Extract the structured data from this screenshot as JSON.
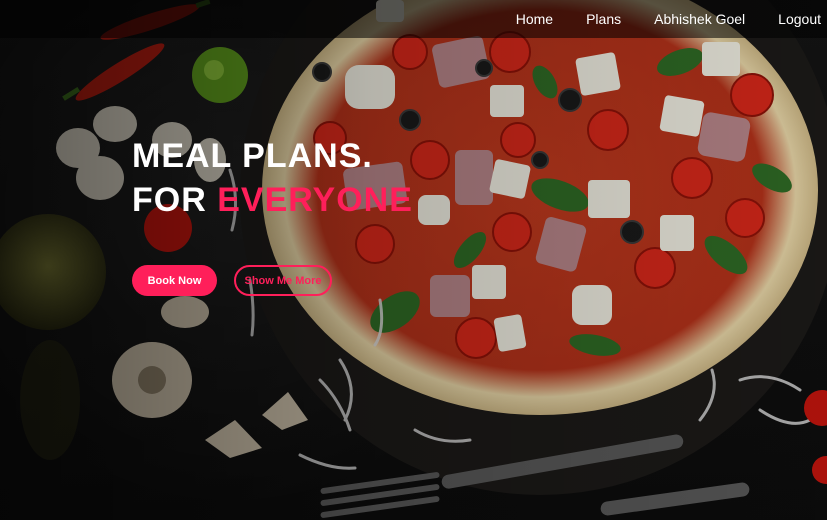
{
  "nav": {
    "items": [
      {
        "label": "Home"
      },
      {
        "label": "Plans"
      },
      {
        "label": "Abhishek Goel"
      },
      {
        "label": "Logout"
      }
    ]
  },
  "hero": {
    "line1": "MEAL PLANS.",
    "line2_prefix": "FOR",
    "line2_accent": "EVERYONE",
    "primary_button": "Book Now",
    "secondary_button": "Show Me More"
  },
  "colors": {
    "accent": "#ff1f5a",
    "navbar": "#000000",
    "text": "#ffffff"
  }
}
